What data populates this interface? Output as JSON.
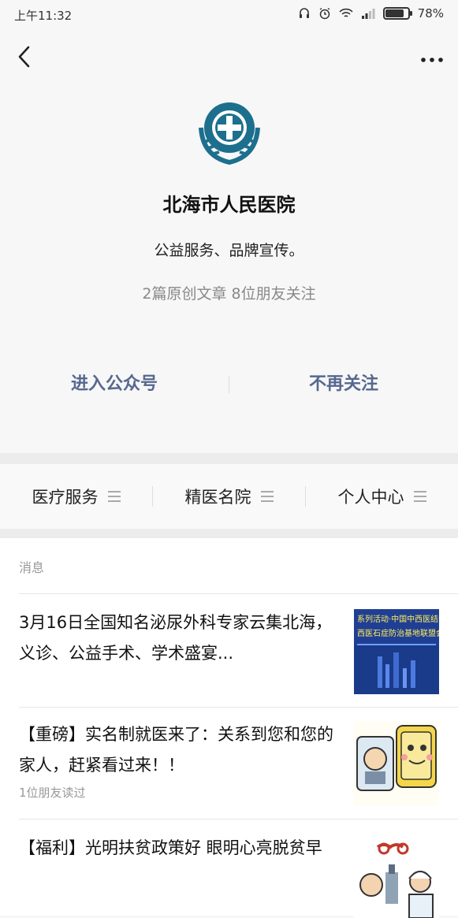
{
  "status": {
    "time": "上午11:32",
    "battery": "78%",
    "battery_level": 0.78
  },
  "nav": {
    "back": "back",
    "more": "more"
  },
  "account": {
    "name": "北海市人民医院",
    "desc": "公益服务、品牌宣传。",
    "stats": "2篇原创文章  8位朋友关注"
  },
  "actions": {
    "enter": "进入公众号",
    "unfollow": "不再关注"
  },
  "menu": [
    {
      "label": "医疗服务"
    },
    {
      "label": "精医名院"
    },
    {
      "label": "个人中心"
    }
  ],
  "messages": {
    "header": "消息",
    "items": [
      {
        "title": "3月16日全国知名泌尿外科专家云集北海，义诊、公益手术、学术盛宴...",
        "meta": "",
        "thumb_text": "系列活动·中国中西医结合泌尿 西医石症防治基地联盟会"
      },
      {
        "title": "【重磅】实名制就医来了：关系到您和您的家人，赶紧看过来！！",
        "meta": "1位朋友读过"
      },
      {
        "title": "【福利】光明扶贫政策好  眼明心亮脱贫早",
        "meta": ""
      }
    ]
  }
}
